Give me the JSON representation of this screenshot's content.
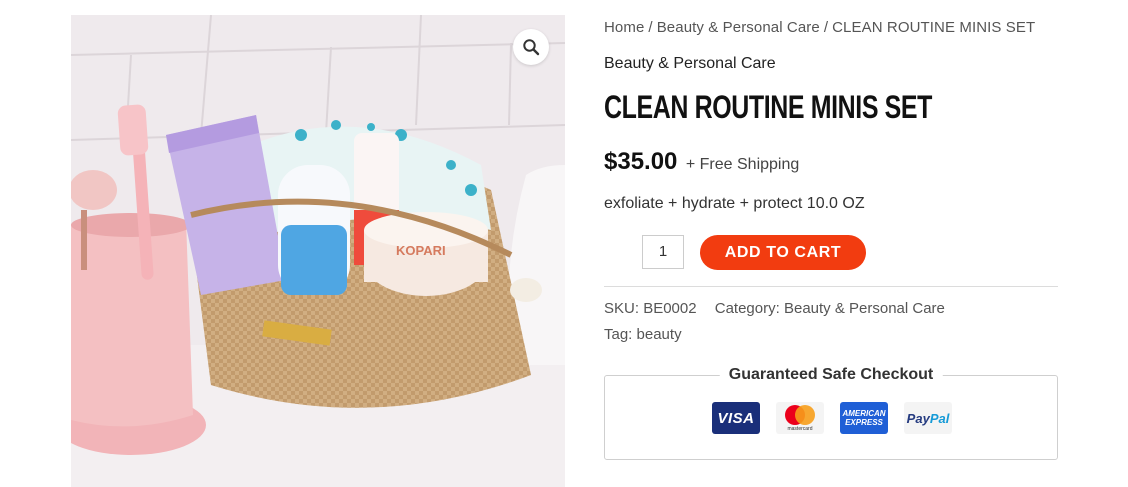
{
  "breadcrumb": {
    "home": "Home",
    "sep1": "/",
    "category": "Beauty & Personal Care",
    "sep2": "/",
    "current": "CLEAN ROUTINE MINIS SET"
  },
  "product": {
    "category": "Beauty & Personal Care",
    "title": "CLEAN ROUTINE MINIS SET",
    "price": "$35.00",
    "shipping": "+ Free Shipping",
    "description": "exfoliate + hydrate + protect 10.0 OZ",
    "quantity": "1",
    "add_to_cart": "ADD TO CART",
    "image_brand_text": "KOPARI"
  },
  "meta": {
    "sku_label": "SKU:",
    "sku": "BE0002",
    "category_label": "Category:",
    "category": "Beauty & Personal Care",
    "tag_label": "Tag:",
    "tag": "beauty"
  },
  "checkout": {
    "title": "Guaranteed Safe Checkout",
    "visa": "VISA",
    "mastercard": "mastercard",
    "amex_line1": "AMERICAN",
    "amex_line2": "EXPRESS",
    "paypal_1": "Pay",
    "paypal_2": "Pal"
  },
  "icons": {
    "zoom": "magnifier-icon"
  },
  "colors": {
    "accent": "#f23c10",
    "visa": "#1a2f7a",
    "amex": "#1f5fd6"
  }
}
